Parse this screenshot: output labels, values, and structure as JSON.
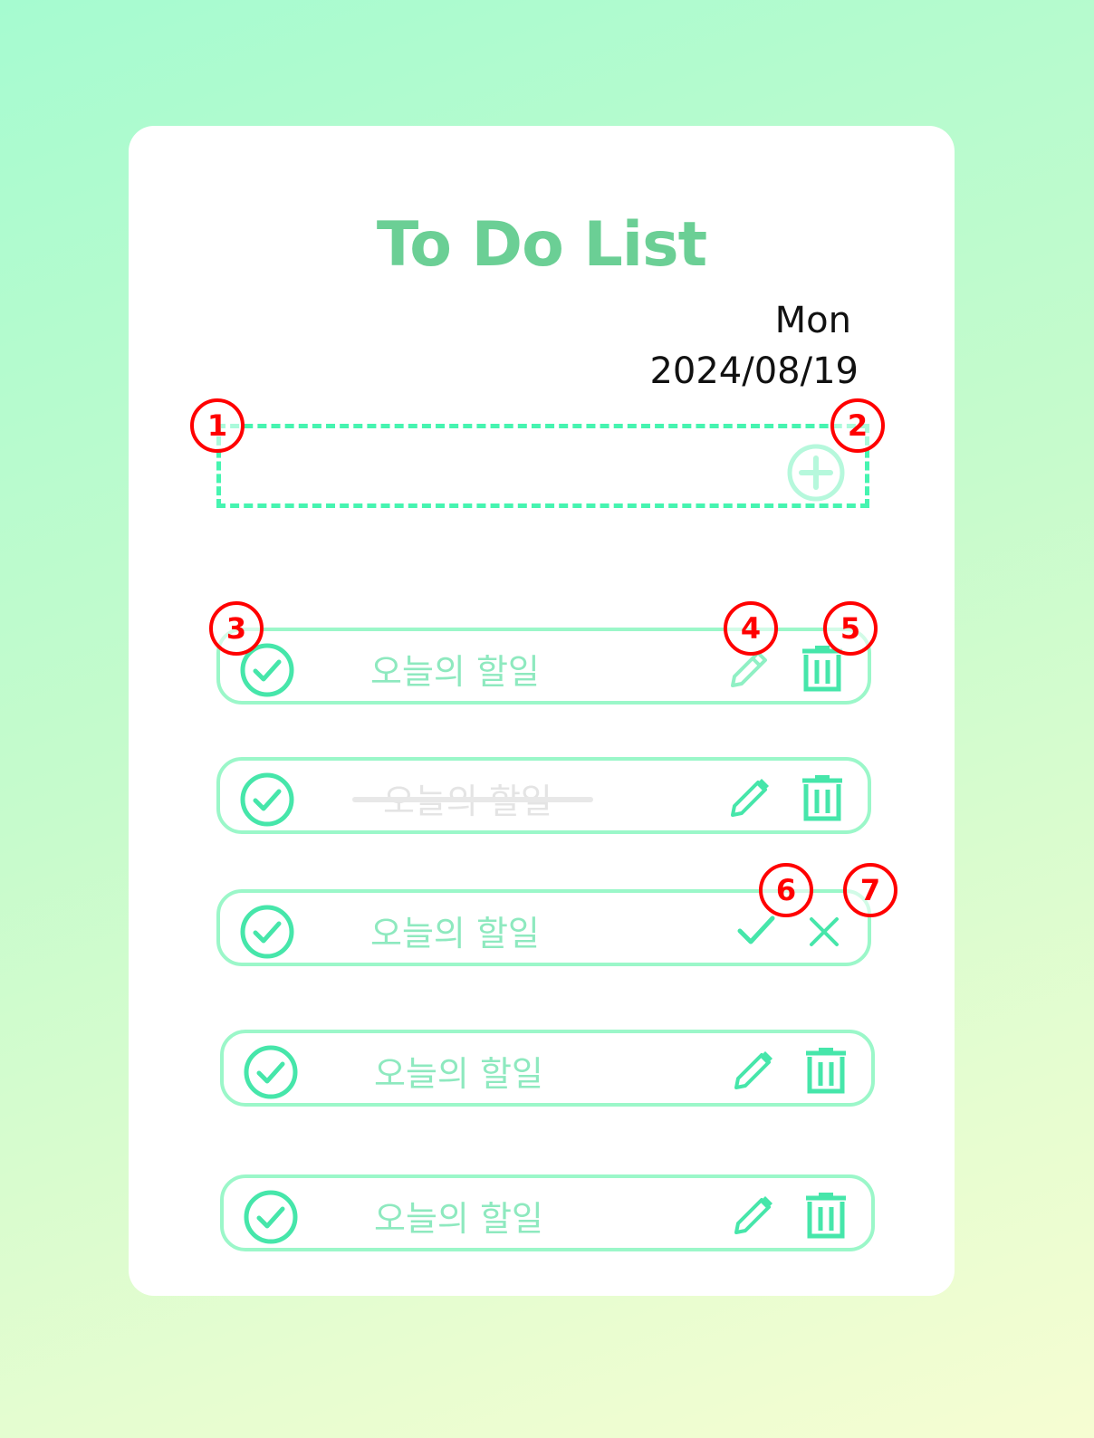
{
  "app": {
    "title": "To Do List",
    "day": "Mon",
    "date": "2024/08/19"
  },
  "input": {
    "placeholder": "",
    "add_icon": "plus-circle-icon"
  },
  "colors": {
    "accent": "#46f4b0",
    "title": "#6bcf95",
    "item_border": "#9bf7c9",
    "annotation": "#ff0000"
  },
  "todos": [
    {
      "text": "오늘의 할일",
      "done": false,
      "mode": "view"
    },
    {
      "text": "오늘의 할일",
      "done": true,
      "mode": "view"
    },
    {
      "text": "오늘의 할일",
      "done": false,
      "mode": "edit"
    },
    {
      "text": "오늘의 할일",
      "done": false,
      "mode": "view"
    },
    {
      "text": "오늘의 할일",
      "done": false,
      "mode": "view"
    }
  ],
  "annotations": [
    "1",
    "2",
    "3",
    "4",
    "5",
    "6",
    "7"
  ]
}
